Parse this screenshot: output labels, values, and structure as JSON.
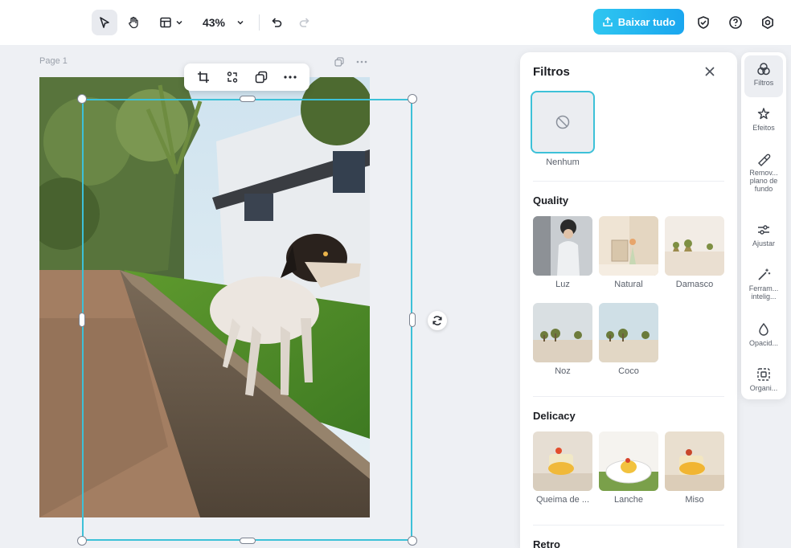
{
  "toolbar": {
    "zoom": "43%",
    "download_label": "Baixar tudo",
    "icons": [
      "pointer-icon",
      "hand-icon",
      "layout-icon",
      "chevron-down-icon",
      "undo-icon",
      "redo-icon",
      "shield-icon",
      "help-icon",
      "settings-icon"
    ]
  },
  "canvas": {
    "page_label": "Page 1",
    "float_toolbar_icons": [
      "crop-icon",
      "flip-icon",
      "duplicate-icon",
      "more-icon"
    ]
  },
  "filters_panel": {
    "title": "Filtros",
    "none_label": "Nenhum",
    "sections": [
      {
        "title": "Quality",
        "items": [
          {
            "label": "Luz"
          },
          {
            "label": "Natural"
          },
          {
            "label": "Damasco"
          },
          {
            "label": "Noz"
          },
          {
            "label": "Coco"
          }
        ]
      },
      {
        "title": "Delicacy",
        "items": [
          {
            "label": "Queima de ..."
          },
          {
            "label": "Lanche"
          },
          {
            "label": "Miso"
          }
        ]
      }
    ],
    "next_section_partial": "Retro"
  },
  "rail": {
    "items": [
      {
        "label": "Filtros",
        "icon": "filters-icon",
        "active": true
      },
      {
        "label": "Efeitos",
        "icon": "effects-icon"
      },
      {
        "label": "Remov... plano de fundo",
        "icon": "remove-bg-icon"
      },
      {
        "label": "Ajustar",
        "icon": "adjust-icon"
      },
      {
        "label": "Ferram... intelig...",
        "icon": "magic-wand-icon"
      },
      {
        "label": "Opacid...",
        "icon": "opacity-icon"
      },
      {
        "label": "Organi...",
        "icon": "arrange-icon"
      }
    ]
  },
  "colors": {
    "accent": "#3dc1d8",
    "download_gradient_start": "#2fc6f0",
    "download_gradient_end": "#1aa6ef"
  }
}
